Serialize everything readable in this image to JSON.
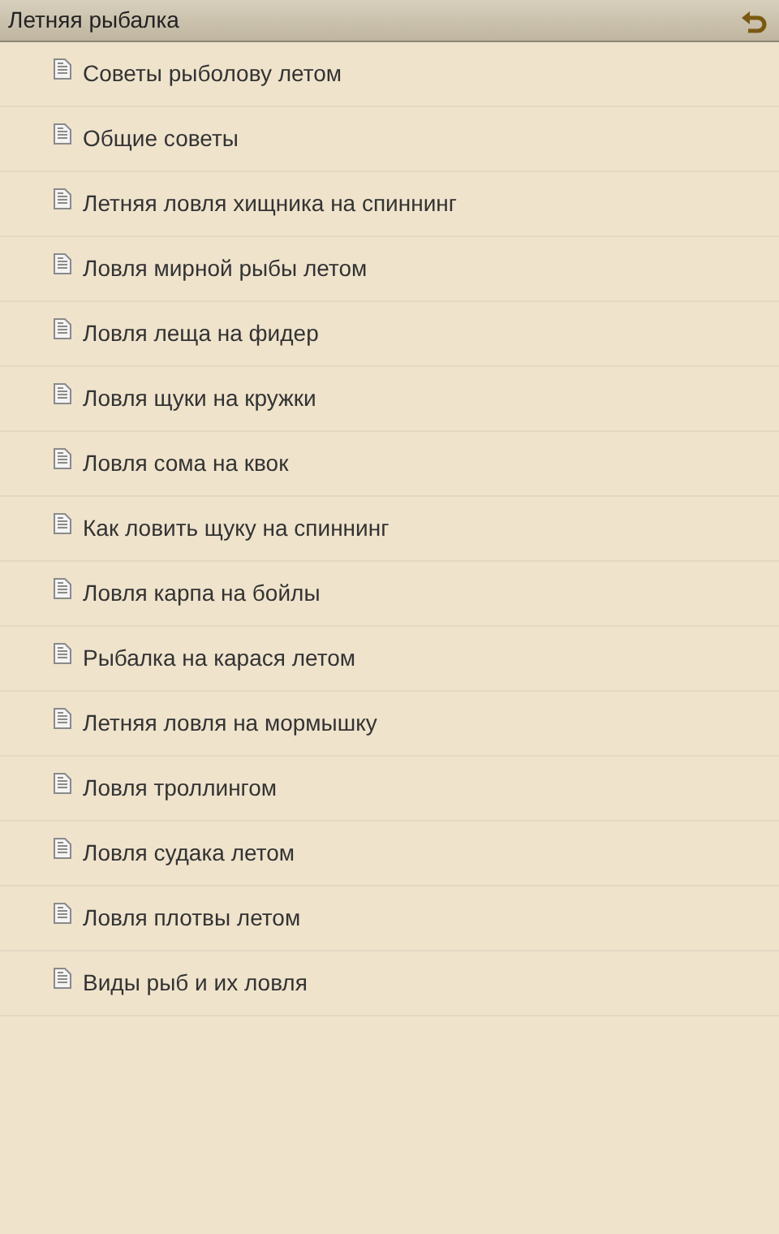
{
  "header": {
    "title": "Летняя рыбалка"
  },
  "items": [
    {
      "label": "Советы рыболову летом"
    },
    {
      "label": "Общие советы"
    },
    {
      "label": "Летняя ловля хищника на спиннинг"
    },
    {
      "label": "Ловля мирной рыбы летом"
    },
    {
      "label": "Ловля леща на фидер"
    },
    {
      "label": "Ловля щуки на кружки"
    },
    {
      "label": "Ловля сома на квок"
    },
    {
      "label": "Как ловить щуку на спиннинг"
    },
    {
      "label": "Ловля карпа на бойлы"
    },
    {
      "label": "Рыбалка на карася летом"
    },
    {
      "label": "Летняя ловля на мормышку"
    },
    {
      "label": "Ловля троллингом"
    },
    {
      "label": "Ловля судака летом"
    },
    {
      "label": "Ловля плотвы летом"
    },
    {
      "label": "Виды рыб и их ловля"
    }
  ]
}
